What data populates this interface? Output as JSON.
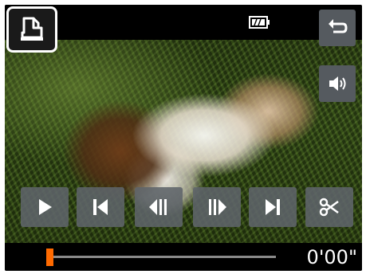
{
  "screen": {
    "top_bar": {
      "print_icon": "print-icon",
      "battery_icon": "battery-icon",
      "back_icon": "back-arrow-icon",
      "volume_icon": "speaker-icon"
    },
    "controls": [
      {
        "name": "play",
        "icon": "play-icon"
      },
      {
        "name": "first-frame",
        "icon": "skip-to-start-icon"
      },
      {
        "name": "previous-frame",
        "icon": "frame-back-icon"
      },
      {
        "name": "next-frame",
        "icon": "frame-forward-icon"
      },
      {
        "name": "last-frame",
        "icon": "skip-to-end-icon"
      },
      {
        "name": "edit",
        "icon": "scissors-icon"
      }
    ],
    "playback": {
      "position_fraction": 0.0,
      "timecode": "0'00\""
    },
    "colors": {
      "progress_thumb": "#ff6a00",
      "button_bg": "#5f646a",
      "frame_border": "#ffffff"
    }
  }
}
